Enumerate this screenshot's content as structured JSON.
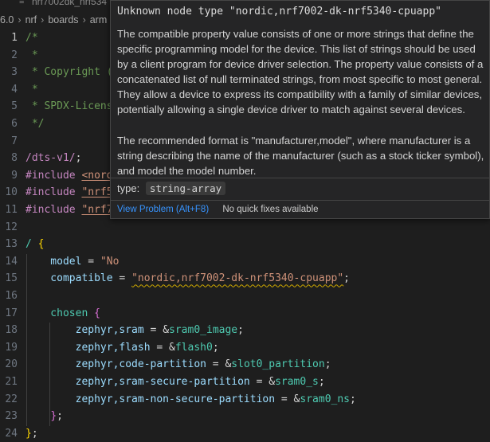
{
  "tab": {
    "filename_fragment": "nrf7002dk_nrf534"
  },
  "breadcrumb": [
    "6.0",
    "nrf",
    "boards",
    "arm"
  ],
  "editor": {
    "lines": [
      {
        "num": "1",
        "parts": [
          {
            "t": "/*",
            "c": "c-comment"
          }
        ]
      },
      {
        "num": "2",
        "parts": [
          {
            "t": " *",
            "c": "c-comment"
          }
        ]
      },
      {
        "num": "3",
        "parts": [
          {
            "t": " * Copyright (",
            "c": "c-comment"
          }
        ]
      },
      {
        "num": "4",
        "parts": [
          {
            "t": " *",
            "c": "c-comment"
          }
        ]
      },
      {
        "num": "5",
        "parts": [
          {
            "t": " * SPDX-License",
            "c": "c-comment"
          }
        ]
      },
      {
        "num": "6",
        "parts": [
          {
            "t": " */",
            "c": "c-comment"
          }
        ]
      },
      {
        "num": "7",
        "parts": []
      },
      {
        "num": "8",
        "parts": [
          {
            "t": "/dts-v1/",
            "c": "c-kw"
          },
          {
            "t": ";",
            "c": "c-id"
          }
        ]
      },
      {
        "num": "9",
        "parts": [
          {
            "t": "#include ",
            "c": "c-kw"
          },
          {
            "t": "<nordi",
            "c": "c-str ul"
          }
        ]
      },
      {
        "num": "10",
        "parts": [
          {
            "t": "#include ",
            "c": "c-kw"
          },
          {
            "t": "\"nrf53",
            "c": "c-str ul"
          }
        ]
      },
      {
        "num": "11",
        "parts": [
          {
            "t": "#include ",
            "c": "c-kw"
          },
          {
            "t": "\"nrf70",
            "c": "c-str ul"
          }
        ]
      },
      {
        "num": "12",
        "parts": []
      },
      {
        "num": "13",
        "parts": [
          {
            "t": "/ ",
            "c": "c-path"
          },
          {
            "t": "{",
            "c": "c-brace"
          }
        ]
      },
      {
        "num": "14",
        "parts": [
          {
            "t": "    model",
            "c": "c-prop"
          },
          {
            "t": " = ",
            "c": "c-id"
          },
          {
            "t": "\"No",
            "c": "c-str"
          }
        ]
      },
      {
        "num": "15",
        "parts": [
          {
            "t": "    compatible",
            "c": "c-prop"
          },
          {
            "t": " = ",
            "c": "c-id"
          },
          {
            "t": "\"nordic,nrf7002-dk-nrf5340-cpuapp\"",
            "c": "c-str squig"
          },
          {
            "t": ";",
            "c": "c-id"
          }
        ]
      },
      {
        "num": "16",
        "parts": []
      },
      {
        "num": "17",
        "parts": [
          {
            "t": "    chosen ",
            "c": "c-path"
          },
          {
            "t": "{",
            "c": "c-brace2"
          }
        ]
      },
      {
        "num": "18",
        "parts": [
          {
            "t": "        zephyr,sram",
            "c": "c-prop"
          },
          {
            "t": " = &",
            "c": "c-id"
          },
          {
            "t": "sram0_image",
            "c": "c-label"
          },
          {
            "t": ";",
            "c": "c-id"
          }
        ]
      },
      {
        "num": "19",
        "parts": [
          {
            "t": "        zephyr,flash",
            "c": "c-prop"
          },
          {
            "t": " = &",
            "c": "c-id"
          },
          {
            "t": "flash0",
            "c": "c-label"
          },
          {
            "t": ";",
            "c": "c-id"
          }
        ]
      },
      {
        "num": "20",
        "parts": [
          {
            "t": "        zephyr,code-partition",
            "c": "c-prop"
          },
          {
            "t": " = &",
            "c": "c-id"
          },
          {
            "t": "slot0_partition",
            "c": "c-label"
          },
          {
            "t": ";",
            "c": "c-id"
          }
        ]
      },
      {
        "num": "21",
        "parts": [
          {
            "t": "        zephyr,sram-secure-partition",
            "c": "c-prop"
          },
          {
            "t": " = &",
            "c": "c-id"
          },
          {
            "t": "sram0_s",
            "c": "c-label"
          },
          {
            "t": ";",
            "c": "c-id"
          }
        ]
      },
      {
        "num": "22",
        "parts": [
          {
            "t": "        zephyr,sram-non-secure-partition",
            "c": "c-prop"
          },
          {
            "t": " = &",
            "c": "c-id"
          },
          {
            "t": "sram0_ns",
            "c": "c-label"
          },
          {
            "t": ";",
            "c": "c-id"
          }
        ]
      },
      {
        "num": "23",
        "parts": [
          {
            "t": "    ",
            "c": "c-id"
          },
          {
            "t": "}",
            "c": "c-brace2"
          },
          {
            "t": ";",
            "c": "c-id"
          }
        ]
      },
      {
        "num": "24",
        "parts": [
          {
            "t": "}",
            "c": "c-brace"
          },
          {
            "t": ";",
            "c": "c-id"
          }
        ]
      }
    ]
  },
  "hover": {
    "title": "Unknown node type \"nordic,nrf7002-dk-nrf5340-cpuapp\"",
    "description": "The compatible property value consists of one or more strings that define the specific programming model for the device. This list of strings should be used by a client program for device driver selection. The property value consists of a concatenated list of null terminated strings, from most specific to most general. They allow a device to express its compatibility with a family of similar devices, potentially allowing a single device driver to match against several devices.",
    "format_note": "The recommended format is \"manufacturer,model\", where manufacturer is a string describing the name of the manufacturer (such as a stock ticker symbol), and model the model number.",
    "type_label": "type:",
    "type_value": "string-array",
    "view_problem": "View Problem (Alt+F8)",
    "no_fixes": "No quick fixes available"
  }
}
